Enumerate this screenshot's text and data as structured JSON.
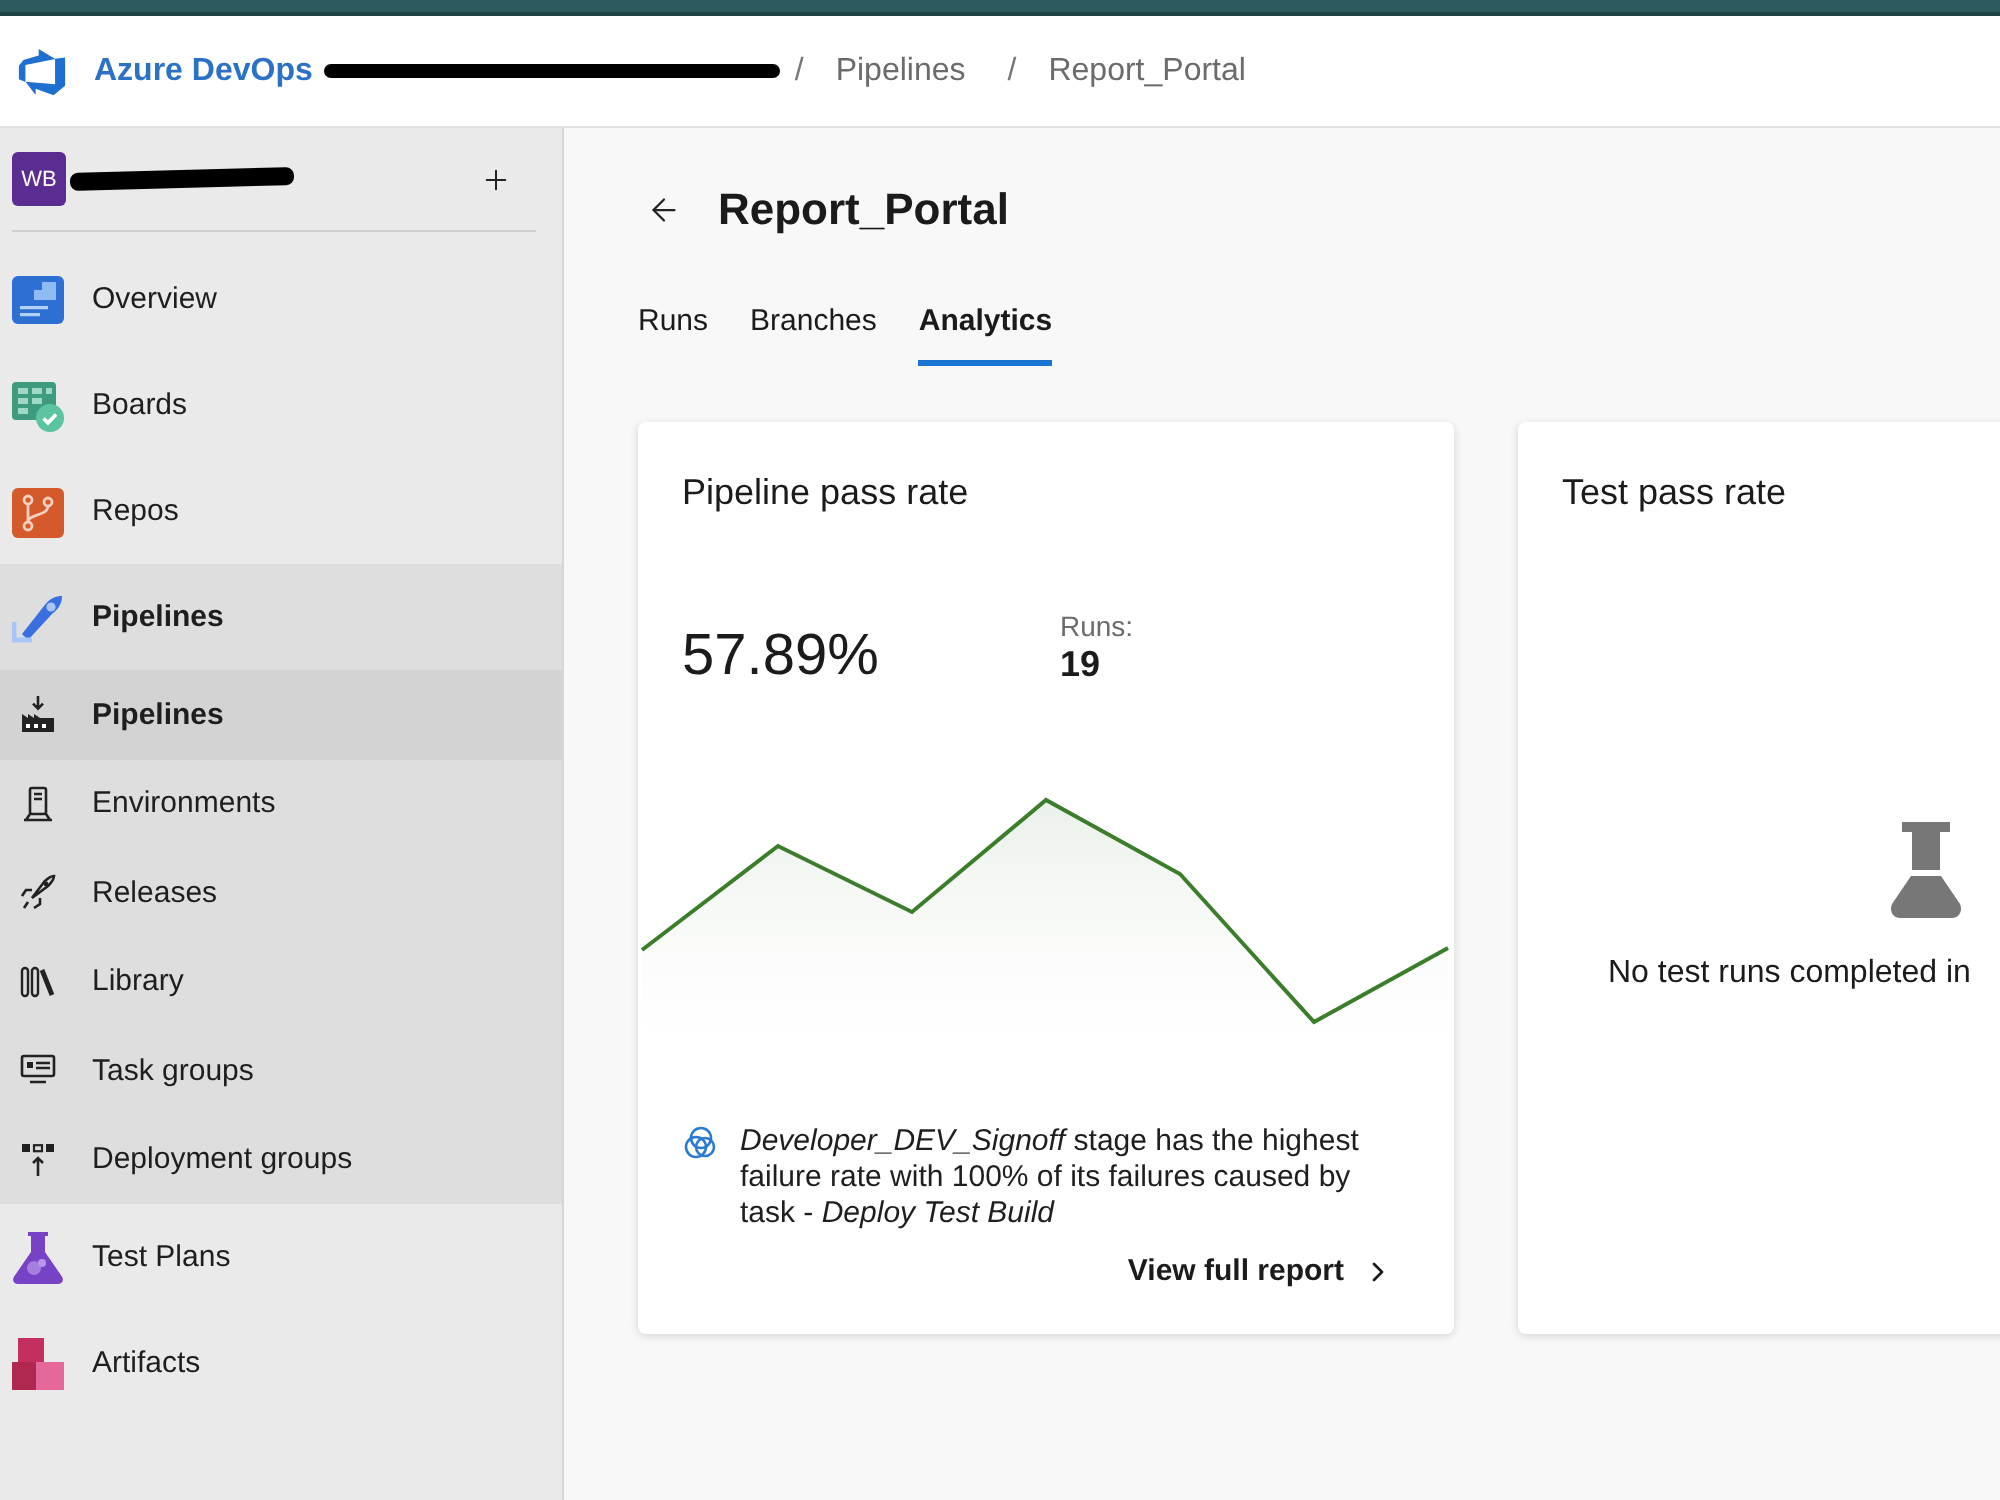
{
  "header": {
    "product": "Azure DevOps",
    "breadcrumb": [
      {
        "kind": "redacted"
      },
      {
        "kind": "separator",
        "text": "/"
      },
      {
        "kind": "link",
        "text": "Pipelines"
      },
      {
        "kind": "separator",
        "text": "/"
      },
      {
        "kind": "link",
        "text": "Report_Portal"
      }
    ]
  },
  "sidebar": {
    "project": {
      "avatar": "WB",
      "name_redacted": true
    },
    "items": [
      {
        "label": "Overview",
        "selected": false,
        "expanded": false
      },
      {
        "label": "Boards",
        "selected": false,
        "expanded": false
      },
      {
        "label": "Repos",
        "selected": false,
        "expanded": false
      },
      {
        "label": "Pipelines",
        "selected": true,
        "expanded": true,
        "children": [
          {
            "label": "Pipelines",
            "selected": true
          },
          {
            "label": "Environments",
            "selected": false
          },
          {
            "label": "Releases",
            "selected": false
          },
          {
            "label": "Library",
            "selected": false
          },
          {
            "label": "Task groups",
            "selected": false
          },
          {
            "label": "Deployment groups",
            "selected": false
          }
        ]
      },
      {
        "label": "Test Plans",
        "selected": false,
        "expanded": false
      },
      {
        "label": "Artifacts",
        "selected": false,
        "expanded": false
      }
    ]
  },
  "page": {
    "title": "Report_Portal",
    "tabs": [
      {
        "label": "Runs",
        "selected": false
      },
      {
        "label": "Branches",
        "selected": false
      },
      {
        "label": "Analytics",
        "selected": true
      }
    ]
  },
  "cards": [
    {
      "kind": "pass_rate",
      "title": "Pipeline pass rate",
      "value": "57.89%",
      "runs_label": "Runs:",
      "runs_value": "19",
      "insight": "*Developer_DEV_Signoff* stage has the highest failure rate with 100% of its failures caused by task - *Deploy Test Build*",
      "link": "View full report"
    },
    {
      "kind": "empty",
      "title": "Test pass rate",
      "message": "No test runs completed in"
    }
  ]
}
